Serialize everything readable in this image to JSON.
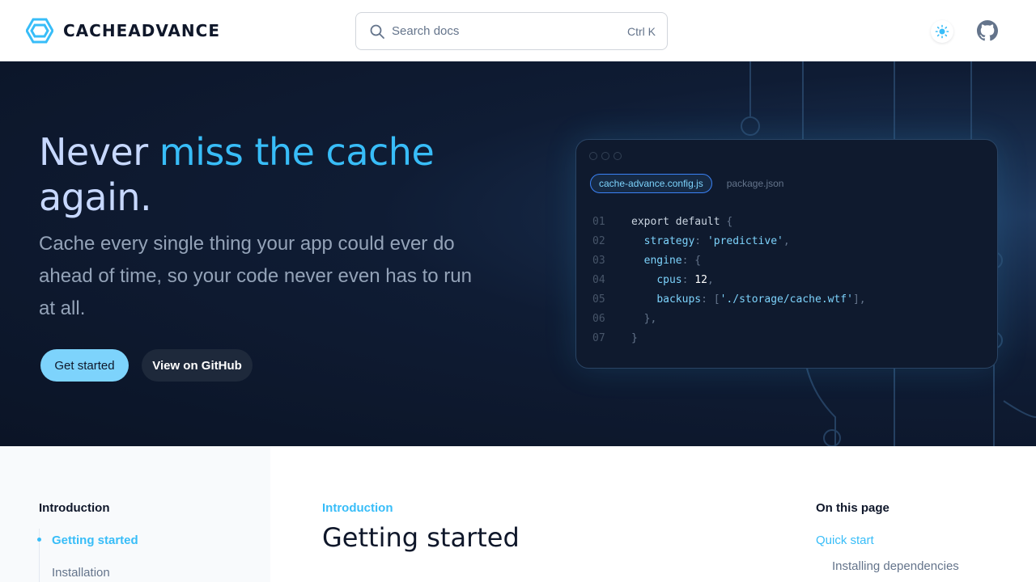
{
  "header": {
    "logo_text": "CACHEADVANCE",
    "search_placeholder": "Search docs",
    "search_shortcut": "Ctrl K",
    "icons": {
      "logo": "hexagon-logo-icon",
      "search": "search-icon",
      "theme": "sun-icon",
      "github": "github-icon"
    }
  },
  "hero": {
    "title_part1": "Never ",
    "title_highlight": "miss the cache",
    "title_part2": "again.",
    "subtitle": "Cache every single thing your app could ever do ahead of time, so your code never even has to run at all.",
    "primary_button": "Get started",
    "secondary_button": "View on GitHub"
  },
  "code_card": {
    "active_tab": "cache-advance.config.js",
    "inactive_tab": "package.json",
    "lines": [
      {
        "num": "01",
        "text": "export default {"
      },
      {
        "num": "02",
        "text": "  strategy: 'predictive',"
      },
      {
        "num": "03",
        "text": "  engine: {"
      },
      {
        "num": "04",
        "text": "    cpus: 12,"
      },
      {
        "num": "05",
        "text": "    backups: ['./storage/cache.wtf'],"
      },
      {
        "num": "06",
        "text": "  },"
      },
      {
        "num": "07",
        "text": "}"
      }
    ]
  },
  "sidebar": {
    "heading": "Introduction",
    "items": [
      "Getting started",
      "Installation"
    ]
  },
  "main": {
    "breadcrumb": "Introduction",
    "title": "Getting started"
  },
  "toc": {
    "heading": "On this page",
    "items": [
      "Quick start",
      "Installing dependencies"
    ]
  },
  "colors": {
    "accent": "#38bdf8",
    "primary_button": "#7dd3fc",
    "hero_bg": "#0f1c34",
    "dark_text": "#0f172a"
  }
}
